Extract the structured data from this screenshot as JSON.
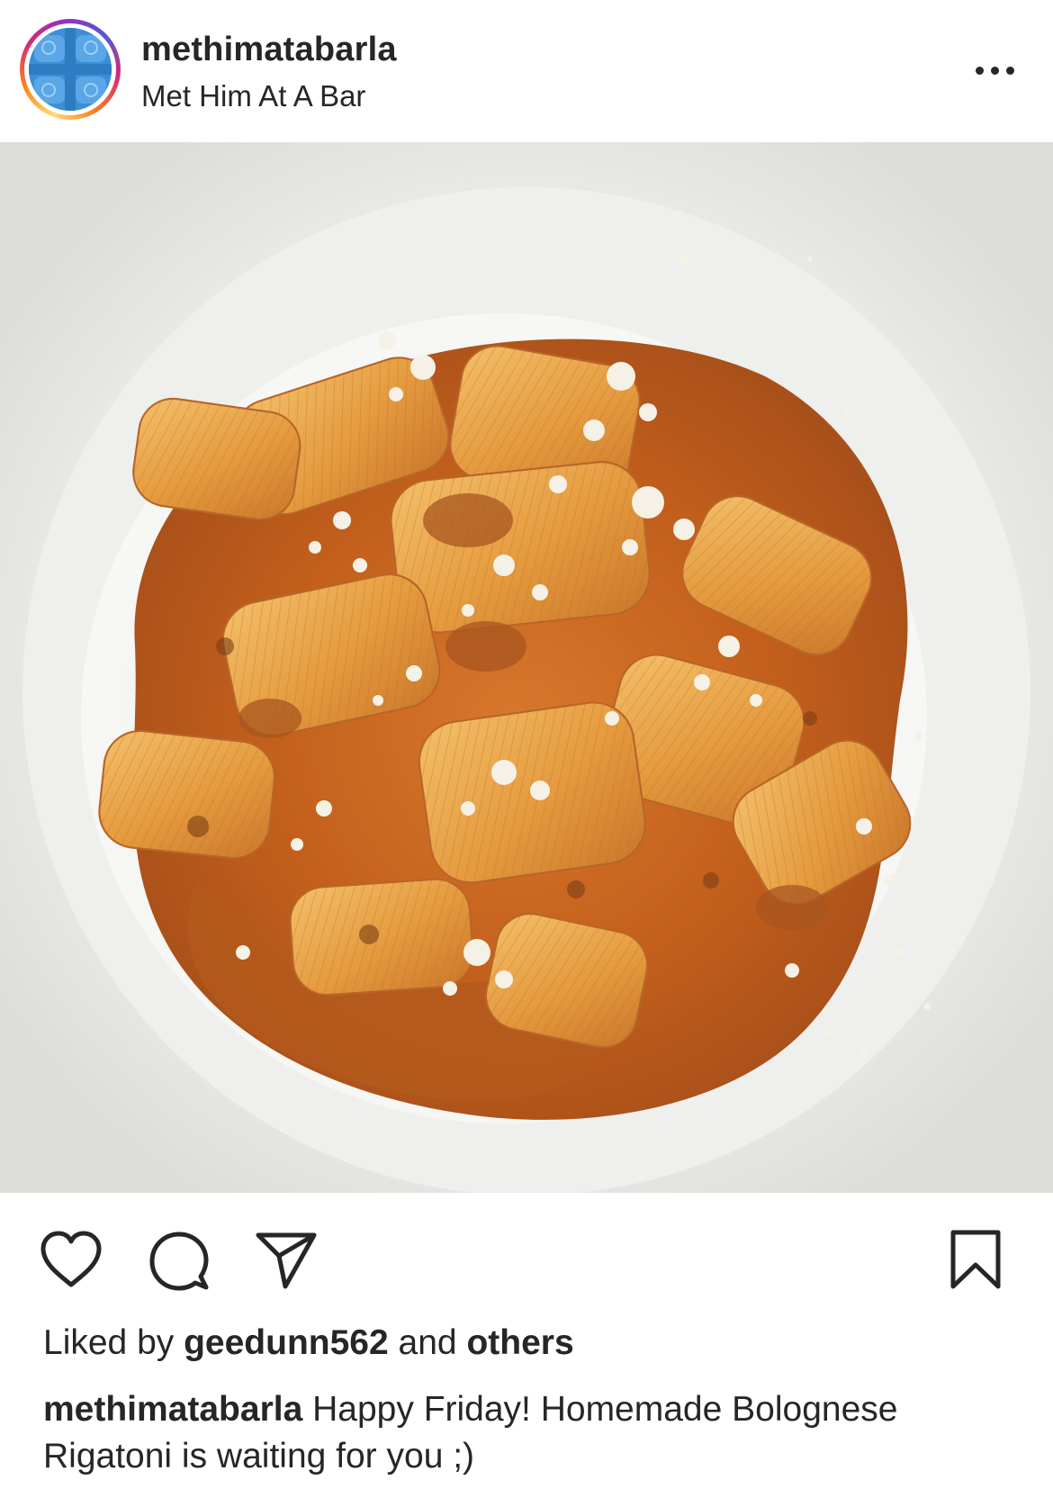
{
  "header": {
    "username": "methimatabarla",
    "location": "Met Him At A Bar",
    "avatar_icon": "avatar-icon",
    "more_icon": "more-options-icon"
  },
  "photo": {
    "icon": "post-photo"
  },
  "actions": {
    "like_icon": "heart-icon",
    "comment_icon": "comment-icon",
    "share_icon": "share-icon",
    "save_icon": "bookmark-icon"
  },
  "likes": {
    "prefix": "Liked by",
    "user": "geedunn562",
    "middle": "and",
    "others": "others"
  },
  "caption": {
    "username": "methimatabarla",
    "text": "Happy Friday! Homemade Bolognese Rigatoni is waiting for you ;)"
  },
  "colors": {
    "text": "#262626",
    "background": "#ffffff",
    "sauce": "#c8621e"
  }
}
